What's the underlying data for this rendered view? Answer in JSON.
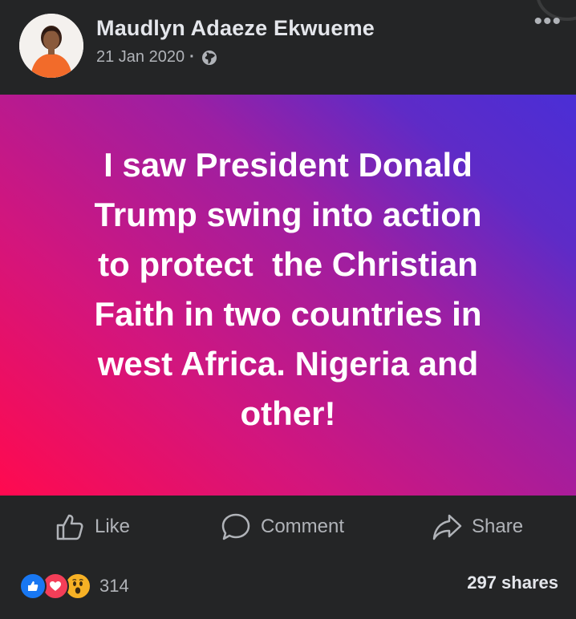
{
  "post": {
    "author": "Maudlyn Adaeze Ekwueme",
    "date": "21 Jan 2020",
    "separator": "·",
    "privacy_icon": "globe-icon",
    "more_icon": "ellipsis-icon",
    "more_label": "•••",
    "text": "I saw President Donald\nTrump swing into action\nto protect  the Christian\nFaith in two countries in\nwest Africa. Nigeria and\nother!",
    "background": {
      "gradient_start": "#ff0a4f",
      "gradient_mid": "#9c1fa3",
      "gradient_end": "#4a2ed6"
    }
  },
  "actions": {
    "like_label": "Like",
    "comment_label": "Comment",
    "share_label": "Share"
  },
  "stats": {
    "reaction_icons": [
      "like-icon",
      "love-icon",
      "wow-icon"
    ],
    "reaction_count": "314",
    "shares": "297 shares"
  },
  "colors": {
    "background": "#242526",
    "text_primary": "#e4e6eb",
    "text_secondary": "#b0b3b8",
    "like_blue": "#1877f2",
    "love_red": "#f33e58",
    "wow_yellow": "#f7b125"
  }
}
